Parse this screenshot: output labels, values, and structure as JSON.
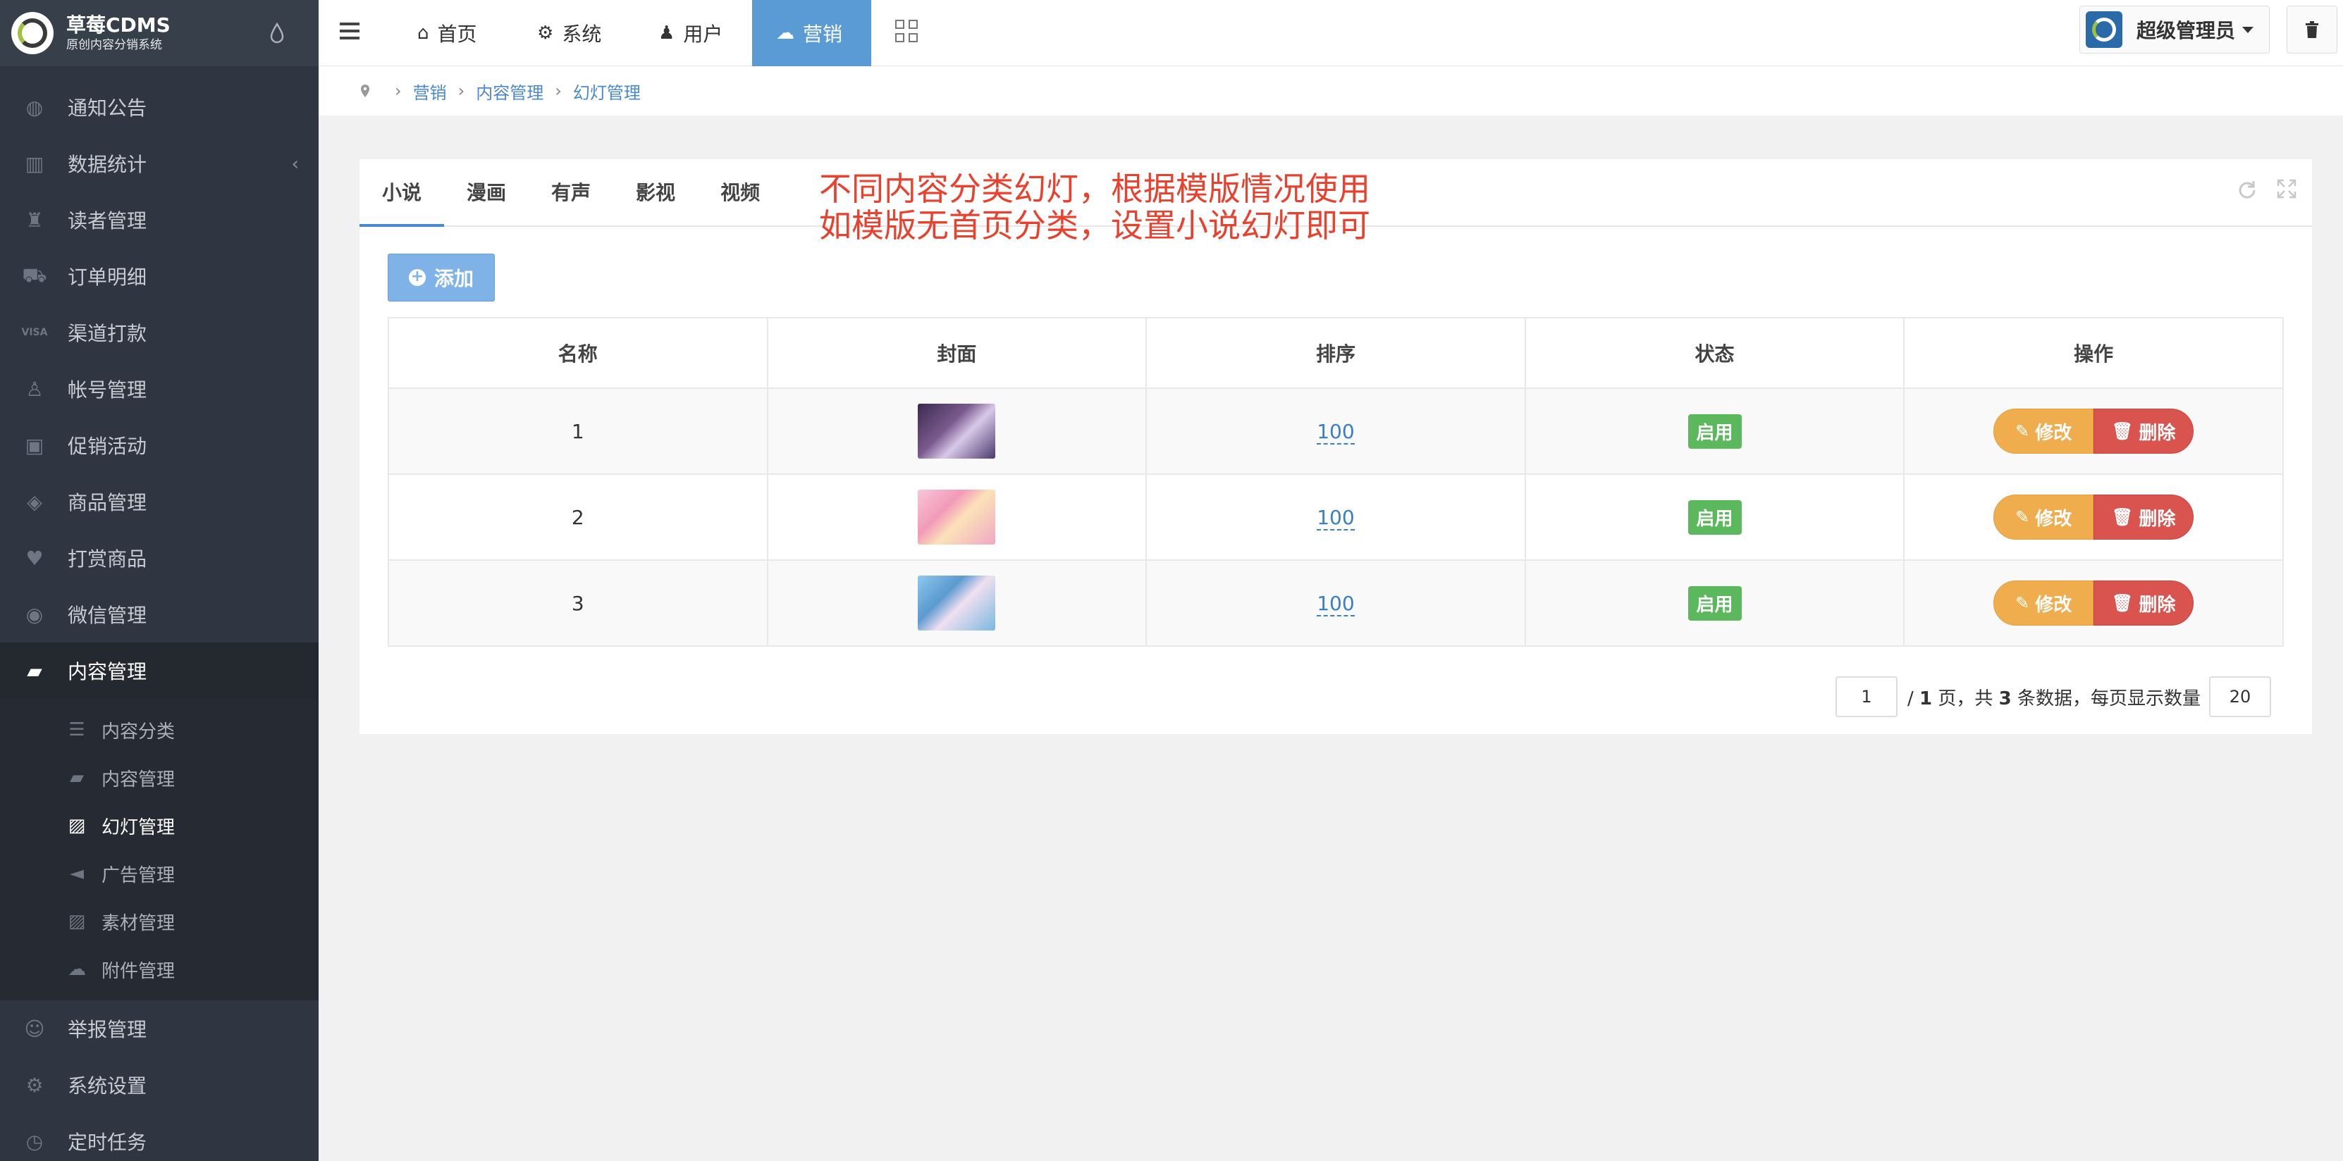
{
  "app": {
    "name": "草莓CDMS",
    "subtitle": "原创内容分销系统"
  },
  "sidebar": {
    "items": [
      {
        "label": "通知公告",
        "icon": "globe-icon"
      },
      {
        "label": "数据统计",
        "icon": "bar-chart-icon"
      },
      {
        "label": "读者管理",
        "icon": "user-lock-icon"
      },
      {
        "label": "订单明细",
        "icon": "cart-icon"
      },
      {
        "label": "渠道打款",
        "icon": "visa-icon"
      },
      {
        "label": "帐号管理",
        "icon": "user-icon"
      },
      {
        "label": "促销活动",
        "icon": "briefcase-icon"
      },
      {
        "label": "商品管理",
        "icon": "diamond-icon"
      },
      {
        "label": "打赏商品",
        "icon": "heart-icon"
      },
      {
        "label": "微信管理",
        "icon": "wechat-icon"
      },
      {
        "label": "内容管理",
        "icon": "book-icon"
      }
    ],
    "sub_items": [
      {
        "label": "内容分类",
        "icon": "list-icon"
      },
      {
        "label": "内容管理",
        "icon": "book-icon"
      },
      {
        "label": "幻灯管理",
        "icon": "image-icon"
      },
      {
        "label": "广告管理",
        "icon": "bullhorn-icon"
      },
      {
        "label": "素材管理",
        "icon": "image-icon"
      },
      {
        "label": "附件管理",
        "icon": "cloud-icon"
      }
    ],
    "bottom_items": [
      {
        "label": "举报管理",
        "icon": "smile-icon"
      },
      {
        "label": "系统设置",
        "icon": "gear-icon"
      },
      {
        "label": "定时任务",
        "icon": "clock-icon"
      }
    ]
  },
  "topbar": {
    "nav": [
      {
        "label": "首页",
        "icon": "home-icon"
      },
      {
        "label": "系统",
        "icon": "gear-icon"
      },
      {
        "label": "用户",
        "icon": "user-icon"
      },
      {
        "label": "营销",
        "icon": "cloud-icon"
      }
    ],
    "user": "超级管理员"
  },
  "breadcrumb": [
    "营销",
    "内容管理",
    "幻灯管理"
  ],
  "tabs": [
    "小说",
    "漫画",
    "有声",
    "影视",
    "视频"
  ],
  "notice": [
    "不同内容分类幻灯，根据模版情况使用",
    "如模版无首页分类，设置小说幻灯即可"
  ],
  "add_label": "添加",
  "table": {
    "headers": [
      "名称",
      "封面",
      "排序",
      "状态",
      "操作"
    ],
    "rows": [
      {
        "name": "1",
        "sort": "100",
        "status": "启用"
      },
      {
        "name": "2",
        "sort": "100",
        "status": "启用"
      },
      {
        "name": "3",
        "sort": "100",
        "status": "启用"
      }
    ],
    "edit_label": "修改",
    "delete_label": "删除"
  },
  "pagination": {
    "current": "1",
    "total_pages": "1",
    "page_word": "页，共",
    "count": "3",
    "count_suffix": "条数据，每页显示数量",
    "page_size": "20"
  },
  "colors": {
    "accent": "#5b9bd5",
    "sidebar": "#2f3541",
    "notice": "#e8412e",
    "success": "#5cb85c",
    "warning": "#f0ad4e",
    "danger": "#d9534f"
  }
}
